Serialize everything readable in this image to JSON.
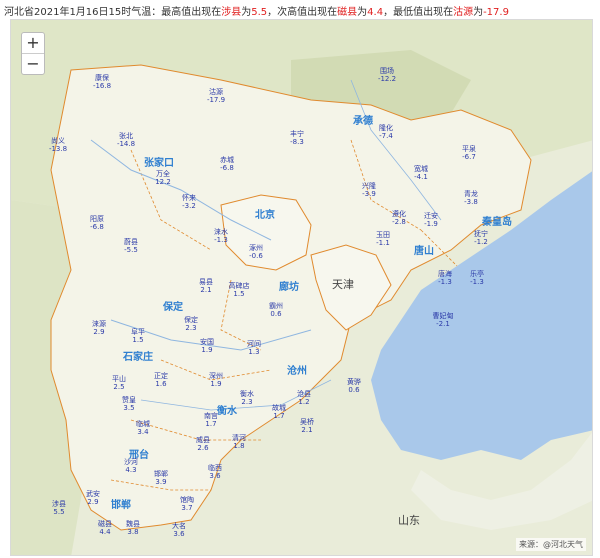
{
  "header": {
    "prefix": "河北省2021年1月16日15时气温：最高值出现在",
    "max_place": "涉县",
    "seg2": "为",
    "max_value": "5.5",
    "seg3": "，次高值出现在",
    "second_place": "磁县",
    "seg4": "为",
    "second_value": "4.4",
    "seg5": "，最低值出现在",
    "min_place": "沽源",
    "seg6": "为",
    "min_value": "-17.9"
  },
  "zoom": {
    "in": "+",
    "out": "−"
  },
  "regions": {
    "tianjin": "天津",
    "shandong": "山东"
  },
  "cities": [
    {
      "name": "张家口"
    },
    {
      "name": "承德"
    },
    {
      "name": "秦皇岛"
    },
    {
      "name": "唐山"
    },
    {
      "name": "保定"
    },
    {
      "name": "沧州"
    },
    {
      "name": "邢台"
    },
    {
      "name": "邯郸"
    },
    {
      "name": "北京"
    },
    {
      "name": "廊坊"
    },
    {
      "name": "石家庄"
    },
    {
      "name": "衡水"
    }
  ],
  "stations": [
    {
      "name": "康保",
      "value": "-16.8"
    },
    {
      "name": "沽源",
      "value": "-17.9"
    },
    {
      "name": "围场",
      "value": "-12.2"
    },
    {
      "name": "尚义",
      "value": "-13.8"
    },
    {
      "name": "张北",
      "value": "-14.8"
    },
    {
      "name": "万全",
      "value": "12.2"
    },
    {
      "name": "丰宁",
      "value": "-8.3"
    },
    {
      "name": "隆化",
      "value": "-7.4"
    },
    {
      "name": "平泉",
      "value": "-6.7"
    },
    {
      "name": "赤城",
      "value": "-6.8"
    },
    {
      "name": "怀来",
      "value": "-3.2"
    },
    {
      "name": "阳原",
      "value": "-6.8"
    },
    {
      "name": "宽城",
      "value": "-4.1"
    },
    {
      "name": "兴隆",
      "value": "-3.9"
    },
    {
      "name": "青龙",
      "value": "-3.8"
    },
    {
      "name": "遵化",
      "value": "-2.8"
    },
    {
      "name": "迁安",
      "value": "-1.9"
    },
    {
      "name": "抚宁",
      "value": "-1.2"
    },
    {
      "name": "玉田",
      "value": "-1.1"
    },
    {
      "name": "蔚县",
      "value": "-5.5"
    },
    {
      "name": "涞水",
      "value": "-1.3"
    },
    {
      "name": "涿州",
      "value": "-0.6"
    },
    {
      "name": "唐海",
      "value": "-1.3"
    },
    {
      "name": "乐亭",
      "value": "-1.3"
    },
    {
      "name": "曹妃甸",
      "value": "-2.1"
    },
    {
      "name": "易县",
      "value": "2.1"
    },
    {
      "name": "高碑店",
      "value": "1.5"
    },
    {
      "name": "保定",
      "value": "2.3"
    },
    {
      "name": "霸州",
      "value": "0.6"
    },
    {
      "name": "涞源",
      "value": "2.9"
    },
    {
      "name": "阜平",
      "value": "1.5"
    },
    {
      "name": "安国",
      "value": "1.9"
    },
    {
      "name": "河间",
      "value": "1.3"
    },
    {
      "name": "黄骅",
      "value": "0.6"
    },
    {
      "name": "沧县",
      "value": "1.2"
    },
    {
      "name": "正定",
      "value": "1.6"
    },
    {
      "name": "平山",
      "value": "2.5"
    },
    {
      "name": "深州",
      "value": "1.9"
    },
    {
      "name": "衡水",
      "value": "2.3"
    },
    {
      "name": "南宫",
      "value": "1.7"
    },
    {
      "name": "故城",
      "value": "1.7"
    },
    {
      "name": "吴桥",
      "value": "2.1"
    },
    {
      "name": "赞皇",
      "value": "3.5"
    },
    {
      "name": "临城",
      "value": "3.4"
    },
    {
      "name": "威县",
      "value": "2.6"
    },
    {
      "name": "清河",
      "value": "1.8"
    },
    {
      "name": "沙河",
      "value": "4.3"
    },
    {
      "name": "武安",
      "value": "2.9"
    },
    {
      "name": "邯郸",
      "value": "3.9"
    },
    {
      "name": "涉县",
      "value": "5.5"
    },
    {
      "name": "磁县",
      "value": "4.4"
    },
    {
      "name": "魏县",
      "value": "3.8"
    },
    {
      "name": "大名",
      "value": "3.6"
    },
    {
      "name": "馆陶",
      "value": "3.7"
    },
    {
      "name": "临西",
      "value": "3.6"
    }
  ],
  "credit": "来源：@河北天气"
}
